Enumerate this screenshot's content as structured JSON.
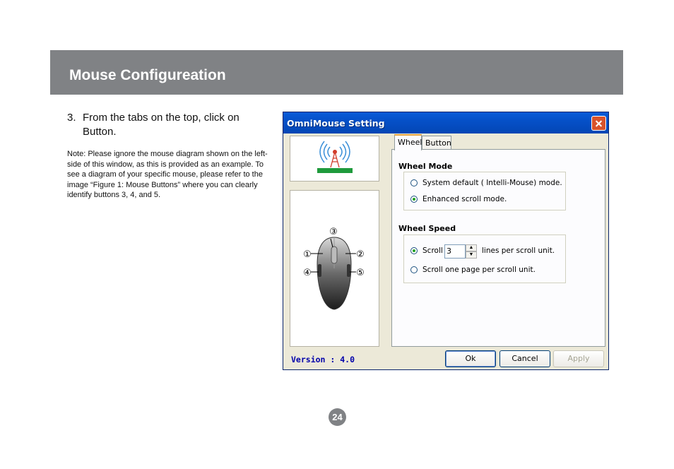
{
  "header": {
    "title": "Mouse Configureation"
  },
  "step": {
    "number": "3.",
    "text": "From the tabs on the top, click on Button."
  },
  "note": "Note:  Please ignore the mouse diagram shown on the left-side of this window, as this is provided as an example.  To see a diagram of your specific mouse, please refer to the image “Figure 1: Mouse Buttons” where you can clearly identify buttons 3, 4, and 5.",
  "dialog": {
    "title": "OmniMouse Setting",
    "tabs": [
      {
        "label": "Wheel",
        "active": true
      },
      {
        "label": "Button",
        "active": false
      }
    ],
    "wheel_mode": {
      "title": "Wheel Mode",
      "options": [
        {
          "label": "System default ( Intelli-Mouse) mode.",
          "checked": false
        },
        {
          "label": "Enhanced scroll mode.",
          "checked": true
        }
      ]
    },
    "wheel_speed": {
      "title": "Wheel Speed",
      "scroll_label": "Scroll",
      "scroll_value": "3",
      "scroll_suffix": "lines per scroll unit.",
      "scroll_checked": true,
      "page_label": "Scroll one page per scroll unit.",
      "page_checked": false
    },
    "mouse_labels": [
      "①",
      "②",
      "③",
      "④",
      "⑤"
    ],
    "version": "Version : 4.0",
    "buttons": {
      "ok": "Ok",
      "cancel": "Cancel",
      "apply": "Apply"
    },
    "colors": {
      "titlebar": "#0550c8",
      "close": "#d9532b",
      "version": "#0000aa"
    }
  },
  "page_number": "24"
}
